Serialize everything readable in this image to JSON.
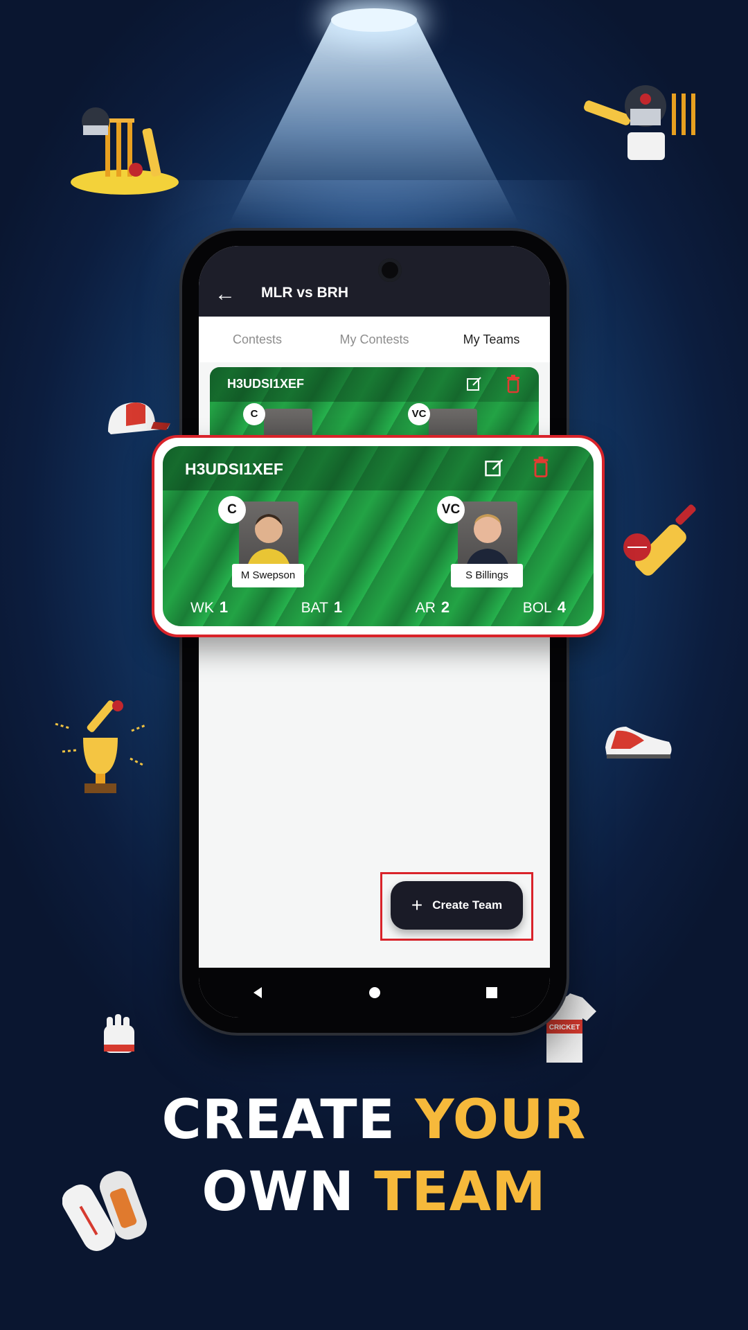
{
  "app": {
    "match_title": "MLR vs BRH",
    "back_icon": "arrow-left-icon"
  },
  "tabs": [
    {
      "label": "Contests",
      "active": false
    },
    {
      "label": "My Contests",
      "active": false
    },
    {
      "label": "My Teams",
      "active": true
    }
  ],
  "team_card": {
    "name": "H3UDSI1XEF",
    "edit_icon": "edit-icon",
    "delete_icon": "trash-icon",
    "captain": {
      "badge": "C",
      "name": "M Swepson"
    },
    "vice_captain": {
      "badge": "VC",
      "name": "S Billings"
    },
    "stats": [
      {
        "label": "WK",
        "value": "1"
      },
      {
        "label": "BAT",
        "value": "1"
      },
      {
        "label": "AR",
        "value": "2"
      },
      {
        "label": "BOL",
        "value": "4"
      }
    ]
  },
  "create_button": {
    "label": "Create Team",
    "icon": "plus-icon"
  },
  "nav": [
    "back-triangle-icon",
    "home-circle-icon",
    "recents-square-icon"
  ],
  "headline": {
    "line1_white": "CREATE ",
    "line1_yellow": "YOUR",
    "line2_white": "OWN ",
    "line2_yellow": "TEAM"
  },
  "colors": {
    "accent_red": "#d9232a",
    "headline_yellow": "#f6b93b",
    "appbar": "#1d1e29",
    "card_green": "#23a345"
  }
}
